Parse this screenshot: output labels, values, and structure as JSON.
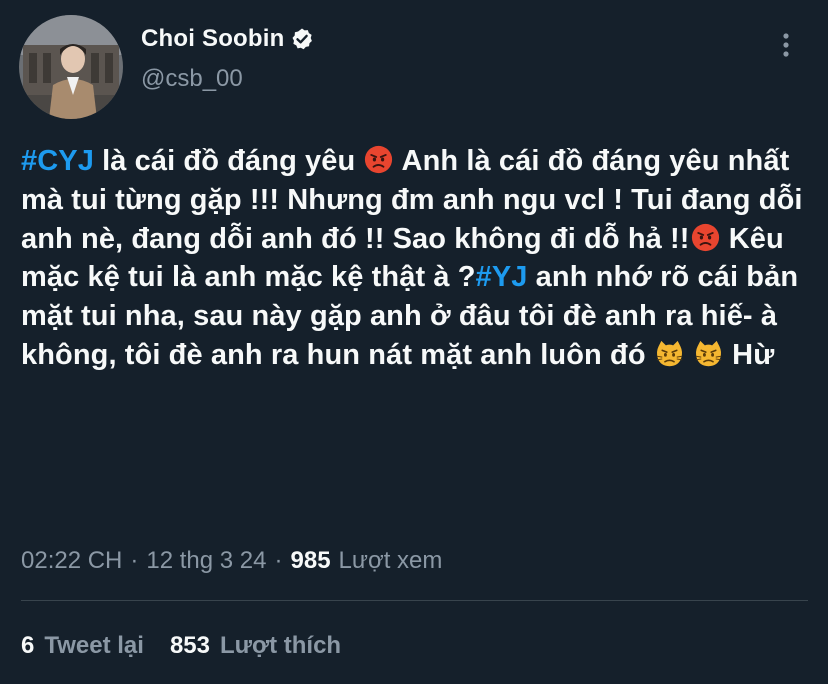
{
  "author": {
    "display_name": "Choi Soobin",
    "handle": "@csb_00",
    "verified": true
  },
  "tweet": {
    "seg1_hashtag": "#CYJ",
    "seg2": " là cái đồ đáng yêu ",
    "seg3": " Anh là cái đồ đáng yêu nhất mà tui từng gặp !!! Nhưng đm anh ngu vcl ! Tui đang dỗi anh nè, đang dỗi anh đó !! Sao không đi dỗ hả !!",
    "seg4": " Kêu mặc kệ tui là anh mặc kệ thật à ?",
    "seg5_hashtag": "#YJ",
    "seg6": " anh nhớ rõ cái bản mặt tui nha, sau này gặp anh ở đâu tôi đè anh ra hiế- à không, tôi đè anh ra hun nát mặt anh luôn đó ",
    "seg7": " Hừ",
    "emojis": [
      "pouting-face",
      "pouting-face",
      "pouting-cat",
      "pouting-cat"
    ]
  },
  "meta": {
    "time": "02:22 CH",
    "separator": "·",
    "date": "12 thg 3 24",
    "views_count": "985",
    "views_label": "Lượt xem"
  },
  "stats": {
    "retweets_count": "6",
    "retweets_label": "Tweet lại",
    "likes_count": "853",
    "likes_label": "Lượt thích"
  },
  "colors": {
    "background": "#15202b",
    "text_primary": "#f7f9f9",
    "text_secondary": "#8b98a5",
    "accent": "#1d9bf0",
    "divider": "#38444d"
  }
}
